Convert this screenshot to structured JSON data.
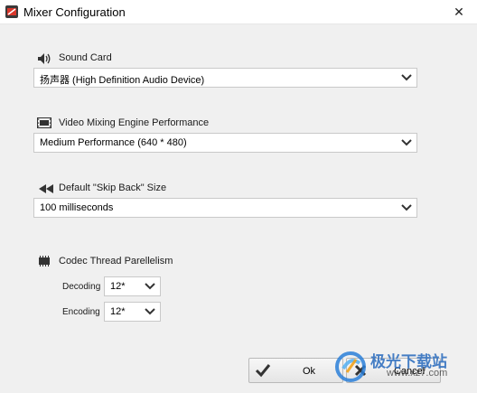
{
  "window": {
    "title": "Mixer Configuration",
    "close_glyph": "✕"
  },
  "sections": {
    "sound_card": {
      "label": "Sound Card",
      "value": "扬声器 (High Definition Audio Device)",
      "icon": "speaker-icon"
    },
    "video_engine": {
      "label": "Video Mixing Engine Performance",
      "value": "Medium Performance (640 * 480)",
      "icon": "film-strip-icon"
    },
    "skip_back": {
      "label": "Default \"Skip Back\" Size",
      "value": "100 milliseconds",
      "icon": "rewind-icon"
    },
    "codec": {
      "label": "Codec Thread Parellelism",
      "icon": "chip-icon",
      "decoding_label": "Decoding",
      "decoding_value": "12*",
      "encoding_label": "Encoding",
      "encoding_value": "12*"
    }
  },
  "buttons": {
    "ok": "Ok",
    "cancel": "Cancel"
  },
  "watermark": {
    "text": "极光下载站",
    "url": "www.xz7.com"
  }
}
